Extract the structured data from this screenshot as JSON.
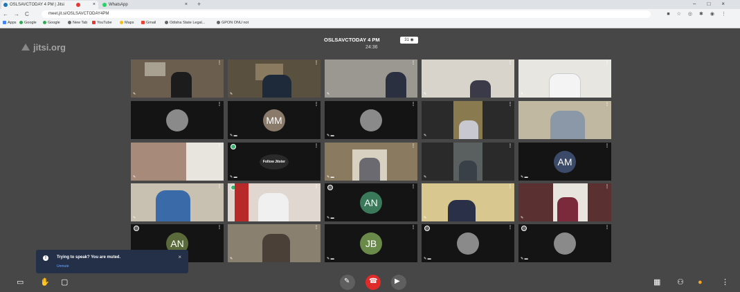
{
  "browser": {
    "tabs": [
      {
        "label": "OSLSAVCTODAY 4 PM | Jitsi",
        "active": true
      },
      {
        "label": "WhatsApp",
        "active": false
      }
    ],
    "url": "meet.jit.si/OSLSAVCTODAY4PM",
    "bookmarks": [
      "Apps",
      "Google",
      "Google",
      "New Tab",
      "YouTube",
      "Maps",
      "Gmail",
      "Odisha State Legal...",
      "GPON ONU not"
    ]
  },
  "meeting": {
    "logo": "jitsi.org",
    "name": "OSLSAVCTODAY 4 PM",
    "participants_badge": "31",
    "timer": "24:36",
    "avatars": {
      "mm": "MM",
      "am": "AM",
      "an1": "AN",
      "an2": "AN",
      "jb": "JB"
    },
    "follow_label": "Follow Jitster"
  },
  "notification": {
    "message": "Trying to speak? You are muted.",
    "action": "Unmute"
  },
  "colors": {
    "stage": "#474747",
    "hangup": "#e02b2b",
    "notice": "#233047",
    "speaker": "#3cb371"
  }
}
